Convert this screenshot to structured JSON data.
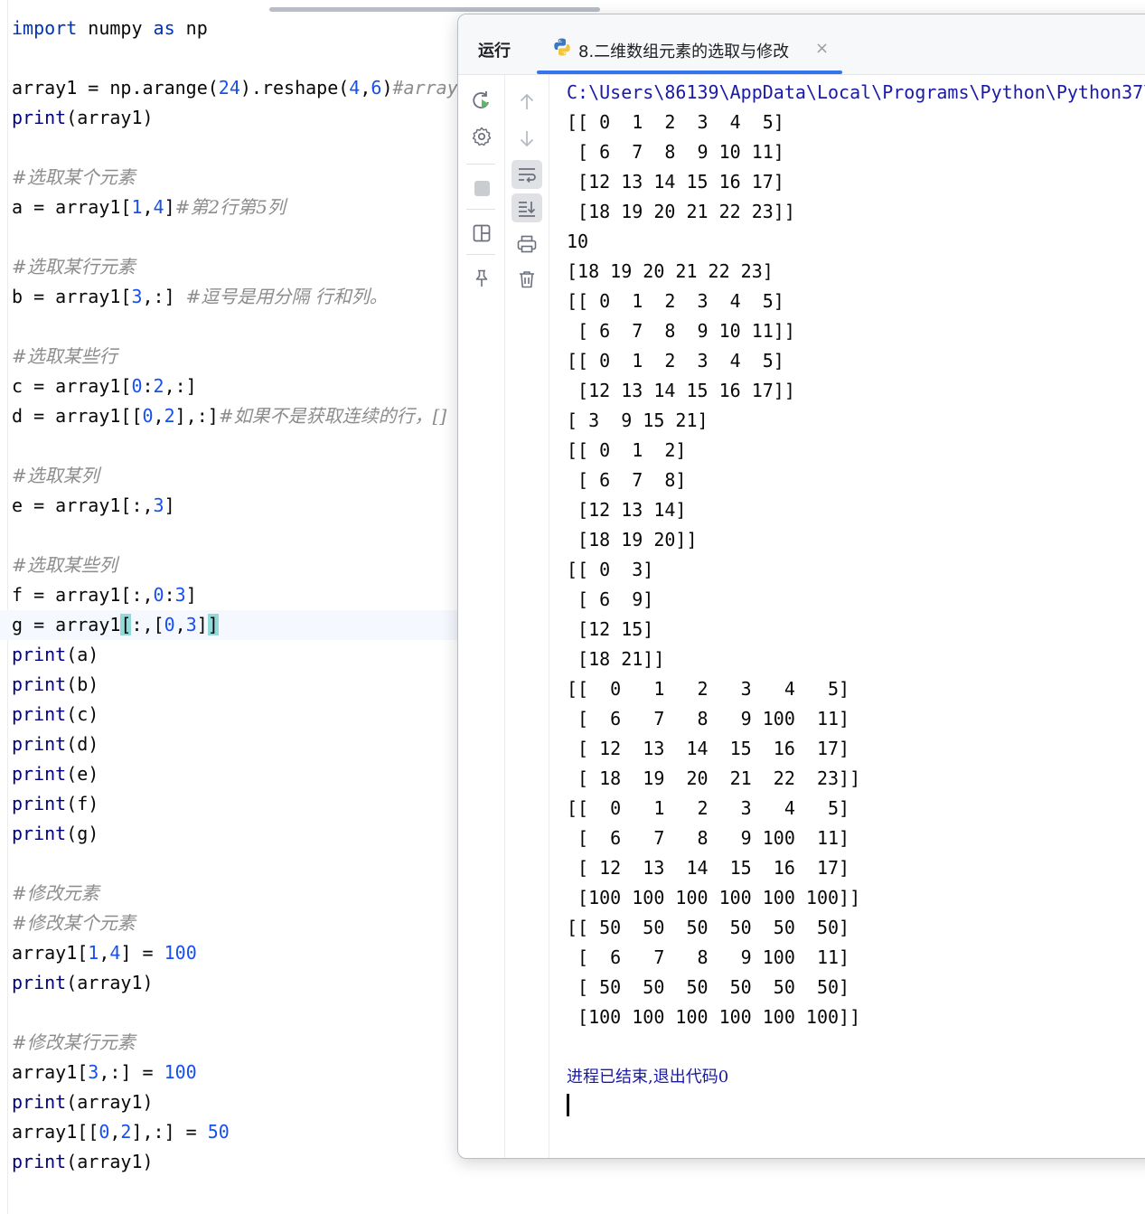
{
  "editor": {
    "lines": [
      "import numpy as np",
      "",
      "array1 = np.arange(24).reshape(4,6)#array",
      "print(array1)",
      "",
      "#选取某个元素",
      "a = array1[1,4]#第2行第5列",
      "",
      "#选取某行元素",
      "b = array1[3,:] #逗号是用分隔 行和列。",
      "",
      "#选取某些行",
      "c = array1[0:2,:]",
      "d = array1[[0,2],:]#如果不是获取连续的行，[]",
      "",
      "#选取某列",
      "e = array1[:,3]",
      "",
      "#选取某些列",
      "f = array1[:,0:3]",
      "g = array1[:,[0,3]]",
      "print(a)",
      "print(b)",
      "print(c)",
      "print(d)",
      "print(e)",
      "print(f)",
      "print(g)",
      "",
      "#修改元素",
      "#修改某个元素",
      "array1[1,4] = 100",
      "print(array1)",
      "",
      "#修改某行元素",
      "array1[3,:] = 100",
      "print(array1)",
      "array1[[0,2],:] = 50",
      "print(array1)"
    ]
  },
  "run_window": {
    "label": "运行",
    "tab_title": "8.二维数组元素的选取与修改",
    "tab_close": "×",
    "toolbar_icons": [
      "rerun-icon",
      "settings-icon",
      "stop-icon",
      "layout-icon",
      "pin-icon",
      "up-arrow-icon",
      "down-arrow-icon",
      "soft-wrap-icon",
      "scroll-to-end-icon",
      "print-icon",
      "trash-icon"
    ],
    "console": [
      "C:\\Users\\86139\\AppData\\Local\\Programs\\Python\\Python37\\",
      "[[ 0  1  2  3  4  5]",
      " [ 6  7  8  9 10 11]",
      " [12 13 14 15 16 17]",
      " [18 19 20 21 22 23]]",
      "10",
      "[18 19 20 21 22 23]",
      "[[ 0  1  2  3  4  5]",
      " [ 6  7  8  9 10 11]]",
      "[[ 0  1  2  3  4  5]",
      " [12 13 14 15 16 17]]",
      "[ 3  9 15 21]",
      "[[ 0  1  2]",
      " [ 6  7  8]",
      " [12 13 14]",
      " [18 19 20]]",
      "[[ 0  3]",
      " [ 6  9]",
      " [12 15]",
      " [18 21]]",
      "[[  0   1   2   3   4   5]",
      " [  6   7   8   9 100  11]",
      " [ 12  13  14  15  16  17]",
      " [ 18  19  20  21  22  23]]",
      "[[  0   1   2   3   4   5]",
      " [  6   7   8   9 100  11]",
      " [ 12  13  14  15  16  17]",
      " [100 100 100 100 100 100]]",
      "[[ 50  50  50  50  50  50]",
      " [  6   7   8   9 100  11]",
      " [ 50  50  50  50  50  50]",
      " [100 100 100 100 100 100]]",
      "",
      "进程已结束,退出代码0"
    ]
  },
  "colors": {
    "keyword": "#0033b3",
    "number": "#1750eb",
    "comment": "#8c8c8c",
    "builtin": "#000080",
    "bracket_match": "#93d9d9",
    "tab_underline": "#3574f0",
    "console_path": "#1a1aa6"
  }
}
